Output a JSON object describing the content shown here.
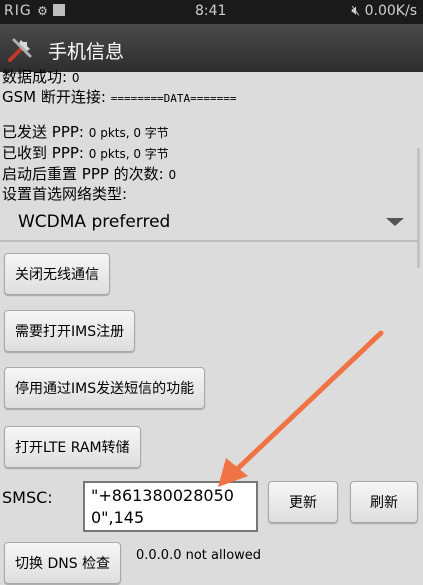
{
  "status_bar": {
    "left": "RIG",
    "time": "8:41",
    "right": "0.00K/s"
  },
  "title_bar": {
    "title": "手机信息"
  },
  "info": {
    "data_success_label": "数据成功:",
    "data_success_value": "0",
    "gsm_disconnect_label": "GSM 断开连接:",
    "gsm_disconnect_value": "========DATA=======",
    "ppp_sent_label": "已发送 PPP:",
    "ppp_sent_value": "0 pkts, 0 字节",
    "ppp_recv_label": "已收到 PPP:",
    "ppp_recv_value": "0 pkts, 0 字节",
    "ppp_reset_label": "启动后重置 PPP 的次数:",
    "ppp_reset_value": "0",
    "network_type_label": "设置首选网络类型:"
  },
  "spinner": {
    "selected": "WCDMA preferred"
  },
  "buttons": {
    "radio_off": "关闭无线通信",
    "ims_register": "需要打开IMS注册",
    "ims_sms": "停用通过IMS发送短信的功能",
    "lte_ram": "打开LTE RAM转储",
    "update": "更新",
    "refresh": "刷新",
    "dns_toggle": "切换 DNS 检查"
  },
  "smsc": {
    "label": "SMSC:",
    "value": "\"+8613800280500\",145"
  },
  "dns": {
    "status": "0.0.0.0 not allowed"
  },
  "colors": {
    "arrow": "#f07345",
    "background": "#dcdcdc",
    "title_bar": "#3a3a3a"
  }
}
